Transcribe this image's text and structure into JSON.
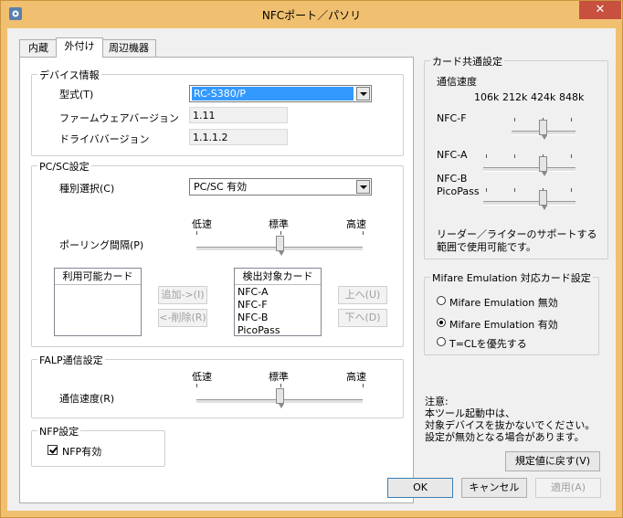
{
  "window": {
    "title": "NFCポート／パソリ",
    "close_glyph": "✕",
    "icon": "gear-icon"
  },
  "tabs": [
    {
      "label": "内蔵",
      "active": false
    },
    {
      "label": "外付け",
      "active": true
    },
    {
      "label": "周辺機器",
      "active": false
    }
  ],
  "device_info": {
    "group_label": "デバイス情報",
    "model_label": "型式(T)",
    "model_value": "RC-S380/P",
    "firmware_label": "ファームウェアバージョン",
    "firmware_value": "1.11",
    "driver_label": "ドライババージョン",
    "driver_value": "1.1.1.2"
  },
  "pcsc": {
    "group_label": "PC/SC設定",
    "type_label": "種別選択(C)",
    "type_value": "PC/SC  有効",
    "polling_label": "ポーリング間隔(P)",
    "scale": [
      "低速",
      "標準",
      "高速"
    ],
    "polling_level": 0.5,
    "available_header": "利用可能カード",
    "available_items": [],
    "detect_header": "検出対象カード",
    "detect_items": [
      "NFC-A",
      "NFC-F",
      "NFC-B",
      "PicoPass"
    ],
    "add_button": "追加->(I)",
    "remove_button": "<-削除(R)",
    "up_button": "上へ(U)",
    "down_button": "下へ(D)"
  },
  "falp": {
    "group_label": "FALP通信設定",
    "speed_label": "通信速度(R)",
    "scale": [
      "低速",
      "標準",
      "高速"
    ],
    "speed_level": 0.5
  },
  "nfp": {
    "group_label": "NFP設定",
    "enable_label": "NFP有効",
    "enabled": true
  },
  "card_common": {
    "group_label": "カード共通設定",
    "speed_heading": "通信速度",
    "speeds": [
      "106k",
      "212k",
      "424k",
      "848k"
    ],
    "rows": [
      {
        "label": "NFC-F",
        "label2": "",
        "selected_index": 2,
        "range_start": 1
      },
      {
        "label": "NFC-A",
        "label2": "",
        "selected_index": 2,
        "range_start": 0
      },
      {
        "label": "NFC-B",
        "label2": "PicoPass",
        "selected_index": 2,
        "range_start": 0
      }
    ],
    "note_line1": "リーダー／ライターのサポートする",
    "note_line2": "範囲で使用可能です。"
  },
  "mifare": {
    "group_label": "Mifare Emulation 対応カード設定",
    "options": [
      {
        "label": "Mifare Emulation 無効",
        "selected": false
      },
      {
        "label": "Mifare Emulation 有効",
        "selected": true
      },
      {
        "label": "T=CLを優先する",
        "selected": false
      }
    ]
  },
  "notice": {
    "heading": "注意:",
    "line1": "本ツール起動中は、",
    "line2": "対象デバイスを抜かないでください。",
    "line3": "設定が無効となる場合があります。"
  },
  "buttons": {
    "restore_defaults": "規定値に戻す(V)",
    "ok": "OK",
    "cancel": "キャンセル",
    "apply": "適用(A)"
  }
}
